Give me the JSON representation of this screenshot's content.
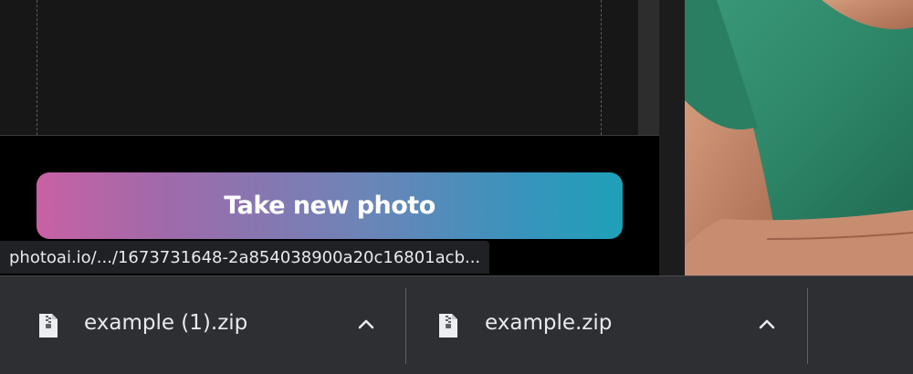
{
  "main": {
    "take_photo_label": "Take new photo"
  },
  "status_bar": {
    "url": "photoai.io/.../1673731648-2a854038900a20c16801acb..."
  },
  "downloads": {
    "items": [
      {
        "filename": "example (1).zip",
        "icon": "zip-file-icon",
        "action_icon": "chevron-up-icon"
      },
      {
        "filename": "example.zip",
        "icon": "zip-file-icon",
        "action_icon": "chevron-up-icon"
      }
    ]
  },
  "colors": {
    "button_gradient_start": "#c861a3",
    "button_gradient_end": "#1ea0b8",
    "shelf_bg": "#2e2f33",
    "shirt_green": "#2f8a6c"
  }
}
